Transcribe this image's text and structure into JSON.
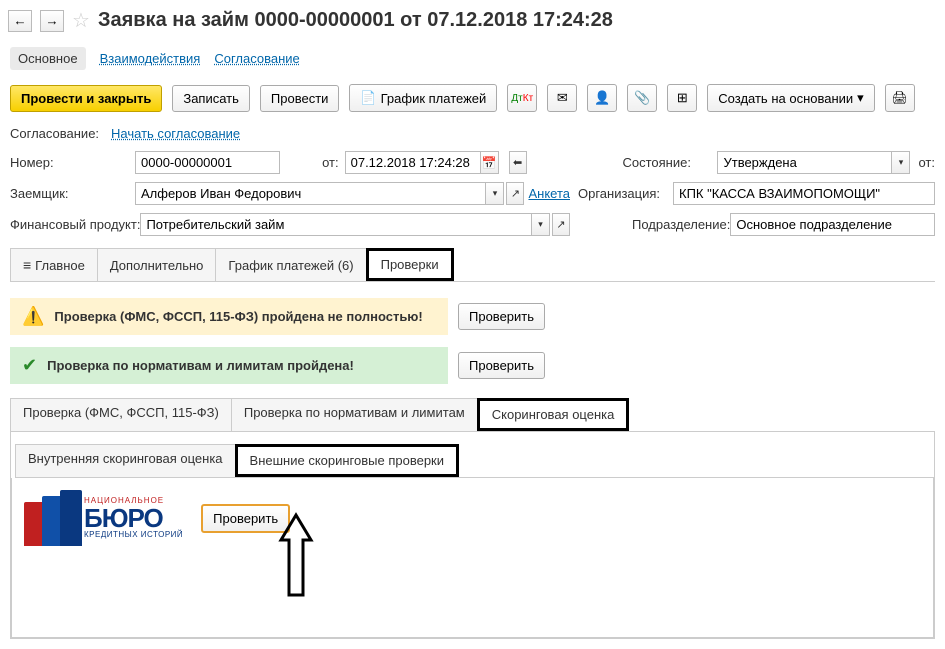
{
  "header": {
    "title": "Заявка на займ 0000-00000001 от 07.12.2018 17:24:28"
  },
  "nav_tabs": {
    "main": "Основное",
    "interactions": "Взаимодействия",
    "approval": "Согласование"
  },
  "toolbar": {
    "post_close": "Провести и закрыть",
    "save": "Записать",
    "post": "Провести",
    "schedule": "График платежей",
    "create_based": "Создать на основании"
  },
  "approval": {
    "label": "Согласование:",
    "start": "Начать согласование"
  },
  "fields": {
    "number_label": "Номер:",
    "number_value": "0000-00000001",
    "date_label": "от:",
    "date_value": "07.12.2018 17:24:28",
    "state_label": "Состояние:",
    "state_value": "Утверждена",
    "state_date_label": "от:",
    "borrower_label": "Заемщик:",
    "borrower_value": "Алферов Иван Федорович",
    "anketa": "Анкета",
    "org_label": "Организация:",
    "org_value": "КПК \"КАССА ВЗАИМОПОМОЩИ\"",
    "product_label": "Финансовый продукт:",
    "product_value": "Потребительский займ",
    "division_label": "Подразделение:",
    "division_value": "Основное подразделение"
  },
  "tabs": {
    "main": "Главное",
    "additional": "Дополнительно",
    "schedule": "График платежей (6)",
    "checks": "Проверки"
  },
  "checks": {
    "warn_text": "Проверка (ФМС, ФССП, 115-ФЗ) пройдена не полностью!",
    "ok_text": "Проверка по нормативам и лимитам пройдена!",
    "check_btn": "Проверить"
  },
  "subtabs": {
    "fms": "Проверка (ФМС, ФССП, 115-ФЗ)",
    "norms": "Проверка по нормативам и лимитам",
    "scoring": "Скоринговая оценка"
  },
  "scoring_subtabs": {
    "internal": "Внутренняя скоринговая оценка",
    "external": "Внешние скоринговые проверки"
  },
  "nbki": {
    "top": "НАЦИОНАЛЬНОЕ",
    "mid": "БЮРО",
    "bot": "КРЕДИТНЫХ ИСТОРИЙ",
    "check_btn": "Проверить"
  }
}
